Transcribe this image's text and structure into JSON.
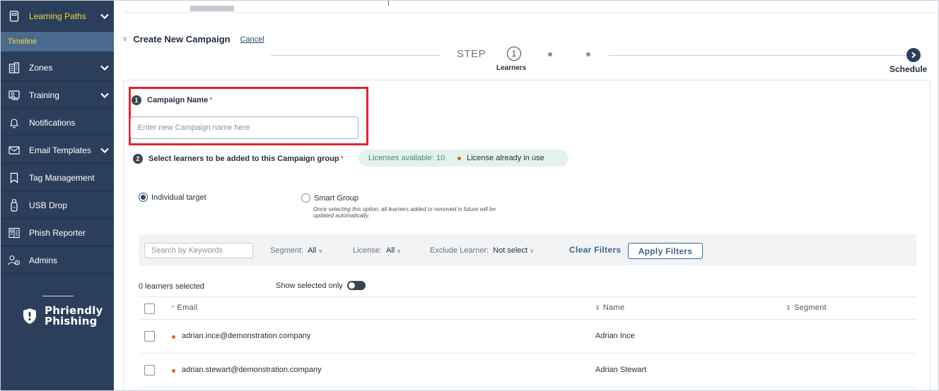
{
  "sidebar": {
    "items": [
      {
        "label": "Learning Paths",
        "icon": "book-icon",
        "has_chevron": true,
        "active": true
      },
      {
        "label": "Zones",
        "icon": "building-icon",
        "has_chevron": true
      },
      {
        "label": "Training",
        "icon": "training-icon",
        "has_chevron": true
      },
      {
        "label": "Notifications",
        "icon": "bell-icon",
        "has_chevron": false
      },
      {
        "label": "Email Templates",
        "icon": "envelope-icon",
        "has_chevron": true
      },
      {
        "label": "Tag Management",
        "icon": "bookmark-icon",
        "has_chevron": false
      },
      {
        "label": "USB Drop",
        "icon": "usb-icon",
        "has_chevron": false
      },
      {
        "label": "Phish Reporter",
        "icon": "report-icon",
        "has_chevron": false
      },
      {
        "label": "Admins",
        "icon": "admins-icon",
        "has_chevron": false
      }
    ],
    "sub_item": "Timeline",
    "logo_line1": "Phriendly",
    "logo_line2": "Phishing"
  },
  "header": {
    "title": "Create New Campaign",
    "cancel": "Cancel"
  },
  "stepper": {
    "label": "STEP",
    "current_step": "1",
    "current_name": "Learners",
    "final_name": "Schedule"
  },
  "form": {
    "step1_number": "1",
    "campaign_name_label": "Campaign Name",
    "required_mark": "*",
    "campaign_name_placeholder": "Enter new Campaign name here",
    "campaign_name_value": "",
    "step2_number": "2",
    "select_learners_label": "Select learners to be added to this Campaign group",
    "licenses_available": "Licenses available: 10",
    "license_in_use": "License already in use",
    "target_options": [
      {
        "label": "Individual target",
        "selected": true
      },
      {
        "label": "Smart Group",
        "selected": false
      }
    ],
    "smart_group_note": "Once selecting this option, all learners added or removed in future will be updated automatically."
  },
  "filters": {
    "search_placeholder": "Search by Keywords",
    "segment_label": "Segment:",
    "segment_value": "All",
    "license_label": "License:",
    "license_value": "All",
    "exclude_label": "Exclude Learner:",
    "exclude_value": "Not select",
    "clear": "Clear Filters",
    "apply": "Apply Filters"
  },
  "selection": {
    "count_text": "0 learners selected",
    "show_selected_label": "Show selected only"
  },
  "table": {
    "columns": [
      {
        "label": "Email",
        "sort_glyph": "^"
      },
      {
        "label": "Name",
        "sort_glyph": "⇕"
      },
      {
        "label": "Segment",
        "sort_glyph": "⇕"
      }
    ],
    "rows": [
      {
        "email": "adrian.ince@demonstration.company",
        "name": "Adrian Ince",
        "segment": ""
      },
      {
        "email": "adrian.stewart@demonstration.company",
        "name": "Adrian Stewart",
        "segment": ""
      }
    ]
  },
  "colors": {
    "sidebar_bg": "#2b3f5c",
    "active_label": "#f2d43a",
    "highlight_border": "#e0262f",
    "accent": "#3e6790",
    "license_pill_bg": "#e3f2ec",
    "status_dot": "#e2622b"
  }
}
